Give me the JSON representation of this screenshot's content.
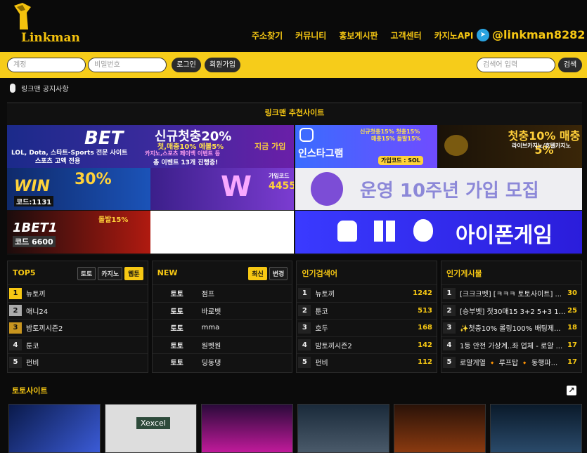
{
  "brand": {
    "logo_text": "Linkman"
  },
  "nav": [
    "주소찾기",
    "커뮤니티",
    "홍보게시판",
    "고객센터",
    "카지노API"
  ],
  "telegram": {
    "handle": "@linkman8282"
  },
  "login": {
    "id_placeholder": "계정",
    "pw_placeholder": "비밀번호",
    "login_label": "로그인",
    "join_label": "회원가입",
    "search_placeholder": "검색어 입력",
    "search_label": "검색"
  },
  "notice": {
    "label": "링크맨 공지사항"
  },
  "recommend": {
    "title": "링크맨 추천사이트",
    "banners": {
      "b1_main": "신규첫충20%",
      "b1_sub": "첫,매충10% 에볼5%",
      "b1_line": "카지노,스포츠 페이백 이벤트 등",
      "b1_line2": "총 이벤트 13개 진행중!",
      "b1_bet": "BET",
      "b1_left": "LOL, Dota, 스타트-Sports 전문 사이트",
      "b1_left2": "스포츠 고액 전용",
      "b1_right": "지금 가입",
      "b2_title": "인스타그램",
      "b2_right": "신규첫충15% 첫충15%",
      "b2_right2": "매충15% 돌발15%",
      "b2_code": "가입코드 : SOL",
      "b3_main": "첫충10% 매충5%",
      "b3_sub": "라이브카지노/호텔카지노",
      "b4_main": "30%",
      "b4_code": "코드:1131",
      "b4_win": "WIN",
      "b5_code": "가입코드",
      "b5_num": "4455",
      "b6_text": "운영 10주년 가입 모집",
      "b7_text": "아이폰게임",
      "b8_brand": "1BET1",
      "b8_code": "코드 6600",
      "b8_main": "돌발15%"
    }
  },
  "top5": {
    "title": "TOP5",
    "tabs": [
      "토토",
      "카지노",
      "웹툰"
    ],
    "items": [
      "뉴토끼",
      "애니24",
      "밤토끼시즌2",
      "툰코",
      "펀비"
    ]
  },
  "new": {
    "title": "NEW",
    "tabs": [
      "최신",
      "변경"
    ],
    "items": [
      {
        "cat": "토토",
        "name": "점프"
      },
      {
        "cat": "토토",
        "name": "바로벳"
      },
      {
        "cat": "토토",
        "name": "mma"
      },
      {
        "cat": "토토",
        "name": "원벳원"
      },
      {
        "cat": "토토",
        "name": "딩동댕"
      }
    ]
  },
  "popular_search": {
    "title": "인기검색어",
    "items": [
      {
        "name": "뉴토끼",
        "count": "1242"
      },
      {
        "name": "툰코",
        "count": "513"
      },
      {
        "name": "호두",
        "count": "168"
      },
      {
        "name": "밤토끼시즌2",
        "count": "142"
      },
      {
        "name": "펀비",
        "count": "112"
      }
    ]
  },
  "popular_posts": {
    "title": "인기게시물",
    "items": [
      {
        "name": "[크크크벳] [ㅋㅋㅋ 토토사이트] ...",
        "count": "30"
      },
      {
        "name": "[승부벳] 첫30매15 3+2 5+3 10...",
        "count": "25"
      },
      {
        "name": "✨첫충10% 롤링100% 배팅제...",
        "count": "18"
      },
      {
        "name": "1등 안전 가상계..좌 업체 - 로얄 ...",
        "count": "17"
      },
      {
        "name": "로얄게열 🔸 루프탑 🔸 동행파...",
        "count": "17"
      }
    ]
  },
  "toto_section": {
    "title": "토토사이트",
    "thumb2_text": "Xexcel"
  },
  "colors": {
    "accent": "#f7c813",
    "dark": "#0b0b0b"
  }
}
